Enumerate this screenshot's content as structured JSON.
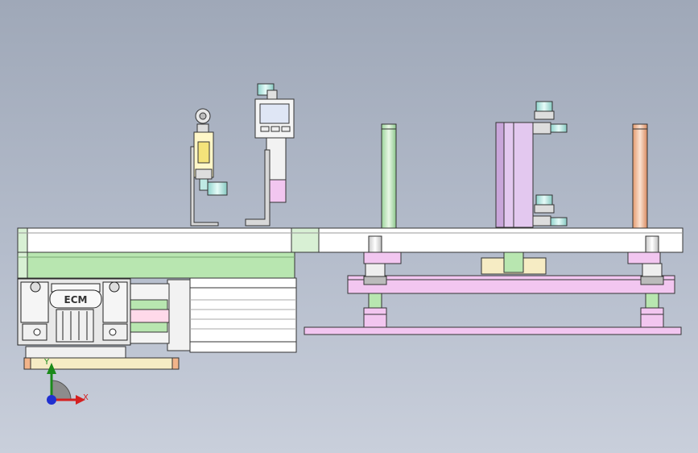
{
  "viewport": {
    "background": "#b3bbca"
  },
  "motor_brand_text": "ECM",
  "triad": {
    "x_label": "X",
    "y_label": "Y",
    "x_color": "#d42020",
    "y_color": "#1a8a1a",
    "z_color": "#2030d0"
  },
  "display": {
    "buttons": 3
  },
  "colors": {
    "mint": "#d8f0d4",
    "green_plate": "#b8e6b0",
    "pink": "#f2c6f0",
    "lilac": "#e3c8ef",
    "beige": "#f6ecc4",
    "orange_rod": "#f2b48a",
    "motor_grey": "#f2f2f2"
  }
}
